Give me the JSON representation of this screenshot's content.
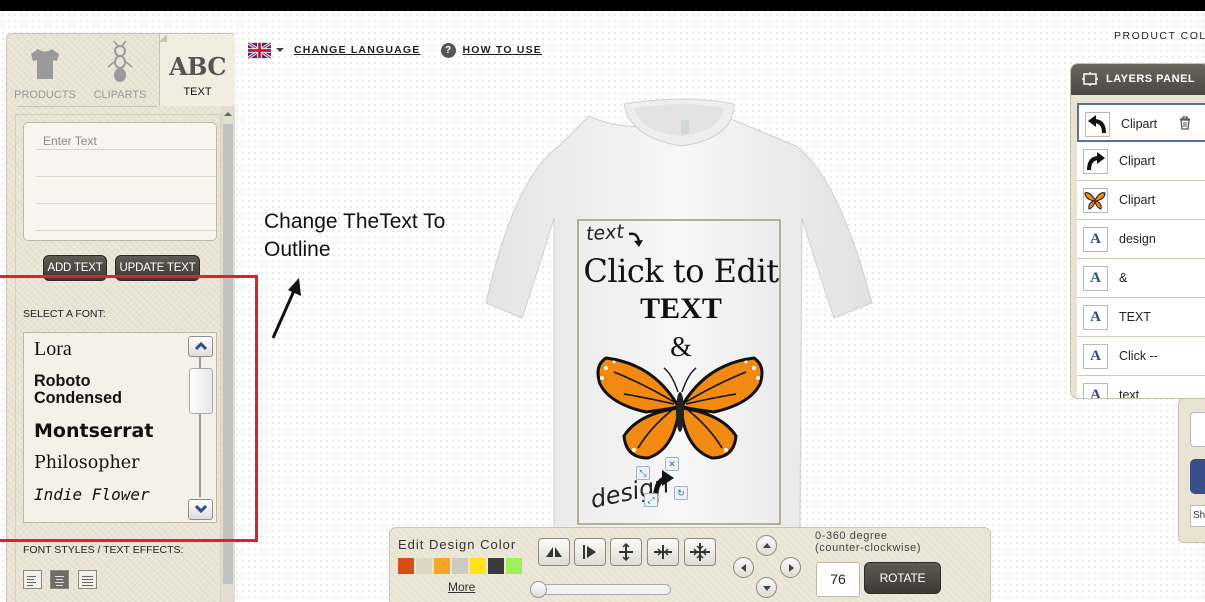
{
  "tabs": [
    {
      "label": "PRODUCTS",
      "icon": "tshirt-icon"
    },
    {
      "label": "CLIPARTS",
      "icon": "ant-clipart-icon"
    },
    {
      "label": "TEXT",
      "glyph": "ABC",
      "active": true
    }
  ],
  "text_panel": {
    "placeholder": "Enter Text",
    "add_label": "ADD TEXT",
    "update_label": "UPDATE TEXT",
    "font_section_label": "SELECT A FONT:",
    "fonts": [
      "Lora",
      "Roboto Condensed",
      "Montserrat",
      "Philosopher",
      "Indie Flower"
    ],
    "styles_label": "FONT STYLES / TEXT EFFECTS:"
  },
  "top_links": {
    "change_language": "CHANGE LANGUAGE",
    "how_to_use": "HOW TO USE",
    "help_glyph": "?"
  },
  "annotation": {
    "line1": "Change TheText To",
    "line2": "Outline"
  },
  "design": {
    "small_text": "text",
    "headline": "Click to Edit",
    "bold_text": "TEXT",
    "amp": "&",
    "script_text": "design"
  },
  "toolbar": {
    "title": "Edit Design Color",
    "swatches": [
      "#d84d12",
      "#ded6c4",
      "#f5a623",
      "#cfcac0",
      "#ffe21a",
      "#3b3b3b",
      "#9ef05a"
    ],
    "more_label": "More",
    "rotation_hint_line1": "0-360 degree",
    "rotation_hint_line2": "(counter-clockwise)",
    "rotation_value": "76",
    "rotate_label": "ROTATE"
  },
  "right": {
    "product_color_label": "PRODUCT COLO",
    "layers_title": "LAYERS PANEL",
    "layers": [
      {
        "name": "Clipart",
        "thumb": "undo-arrow-icon",
        "selected": true
      },
      {
        "name": "Clipart",
        "thumb": "redo-arrow-icon"
      },
      {
        "name": "Clipart",
        "thumb": "butterfly-icon"
      },
      {
        "name": "design",
        "thumb": "A"
      },
      {
        "name": "&",
        "thumb": "A"
      },
      {
        "name": "TEXT",
        "thumb": "A"
      },
      {
        "name": "Click --",
        "thumb": "A"
      },
      {
        "name": "text",
        "thumb": "A"
      }
    ],
    "fragment_label": "Sh"
  },
  "colors": {
    "highlight": "#e0202a",
    "butterfly": "#f28a12",
    "panel_bg": "#e8e3d3",
    "dark_button": "#4a4841",
    "layer_accent": "#2e4d8e"
  }
}
